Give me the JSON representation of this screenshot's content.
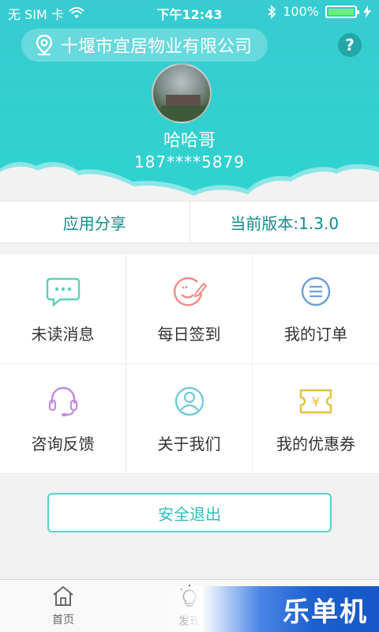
{
  "status_bar": {
    "carrier": "无 SIM 卡",
    "time": "下午12:43",
    "battery": "100%",
    "battery_level": 1.0
  },
  "header": {
    "location": "十堰市宜居物业有限公司",
    "help": "?",
    "user_name": "哈哈哥",
    "phone": "187****5879"
  },
  "info_row": {
    "share": "应用分享",
    "version": "当前版本:1.3.0"
  },
  "menu": [
    {
      "label": "未读消息",
      "icon": "chat-bubble-icon",
      "color": "#5fcfb9"
    },
    {
      "label": "每日签到",
      "icon": "smile-pen-icon",
      "color": "#f28a86"
    },
    {
      "label": "我的订单",
      "icon": "list-icon",
      "color": "#6a9fd8"
    },
    {
      "label": "咨询反馈",
      "icon": "headset-icon",
      "color": "#c38be0"
    },
    {
      "label": "关于我们",
      "icon": "user-circle-icon",
      "color": "#6fcbd6"
    },
    {
      "label": "我的优惠券",
      "icon": "coupon-icon",
      "color": "#e3c13d"
    }
  ],
  "logout": "安全退出",
  "tabs": {
    "home": "首页",
    "discover": "发现"
  },
  "watermark": "乐单机",
  "colors": {
    "accent": "#2fd3cf",
    "accent_text": "#148b8a"
  }
}
